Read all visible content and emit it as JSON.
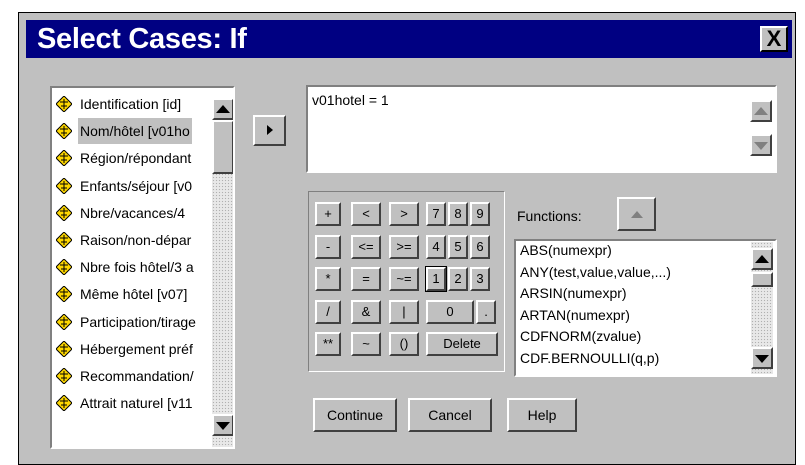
{
  "window": {
    "title": "Select Cases: If",
    "close_label": "X"
  },
  "variables": [
    {
      "label": "Identification [id]",
      "selected": false
    },
    {
      "label": "Nom/hôtel [v01ho",
      "selected": true
    },
    {
      "label": "Région/répondant",
      "selected": false
    },
    {
      "label": "Enfants/séjour [v0",
      "selected": false
    },
    {
      "label": "Nbre/vacances/4",
      "selected": false
    },
    {
      "label": "Raison/non-dépar",
      "selected": false
    },
    {
      "label": "Nbre fois hôtel/3 a",
      "selected": false
    },
    {
      "label": "Même hôtel [v07]",
      "selected": false
    },
    {
      "label": "Participation/tirage",
      "selected": false
    },
    {
      "label": "Hébergement préf",
      "selected": false
    },
    {
      "label": "Recommandation/",
      "selected": false
    },
    {
      "label": "Attrait naturel [v11",
      "selected": false
    }
  ],
  "expression": {
    "value": "v01hotel = 1"
  },
  "keypad": {
    "row1": [
      "+",
      "<",
      ">",
      "7",
      "8",
      "9"
    ],
    "row2": [
      "-",
      "<=",
      ">=",
      "4",
      "5",
      "6"
    ],
    "row3": [
      "*",
      "=",
      "~=",
      "1",
      "2",
      "3"
    ],
    "row4": [
      "/",
      "&",
      "|",
      "0",
      "."
    ],
    "row5": [
      "**",
      "~",
      "()",
      "Delete"
    ]
  },
  "functions": {
    "label": "Functions:",
    "items": [
      "ABS(numexpr)",
      "ANY(test,value,value,...)",
      "ARSIN(numexpr)",
      "ARTAN(numexpr)",
      "CDFNORM(zvalue)",
      "CDF.BERNOULLI(q,p)"
    ]
  },
  "buttons": {
    "continue": "Continue",
    "cancel": "Cancel",
    "help": "Help"
  },
  "icons": {
    "variable": "diamond-scale-icon",
    "move": "right-arrow-icon",
    "paste_function": "up-arrow-icon"
  }
}
